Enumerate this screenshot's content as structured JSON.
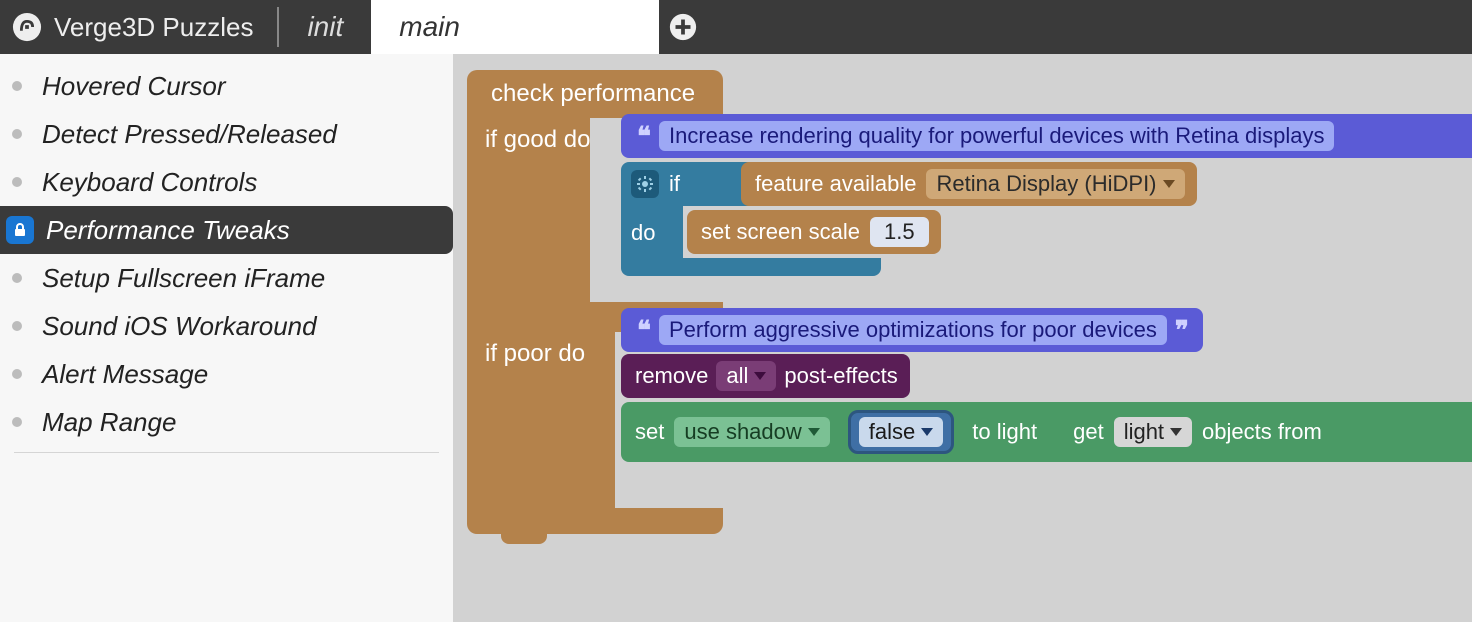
{
  "header": {
    "app_title": "Verge3D Puzzles",
    "tab_init": "init",
    "tab_main": "main"
  },
  "sidebar": {
    "items": [
      {
        "label": "Hovered Cursor"
      },
      {
        "label": "Detect Pressed/Released"
      },
      {
        "label": "Keyboard Controls"
      },
      {
        "label": "Performance Tweaks"
      },
      {
        "label": "Setup Fullscreen iFrame"
      },
      {
        "label": "Sound iOS Workaround"
      },
      {
        "label": "Alert Message"
      },
      {
        "label": "Map Range"
      }
    ],
    "active_index": 3
  },
  "blocks": {
    "check_performance": "check performance",
    "if_good_do": "if good do",
    "if_poor_do": "if poor do",
    "comment_good": "Increase rendering quality for powerful devices with Retina displays",
    "comment_poor": "Perform aggressive optimizations for poor devices",
    "if_word": "if",
    "do_word": "do",
    "feature_available": "feature available",
    "retina_option": "Retina Display (HiDPI)",
    "set_screen_scale": "set screen scale",
    "scale_value": "1.5",
    "remove": "remove",
    "all_option": "all",
    "post_effects": "post-effects",
    "set": "set",
    "use_shadow": "use shadow",
    "false_val": "false",
    "to_light": "to light",
    "get": "get",
    "light_option": "light",
    "objects_from": "objects from"
  }
}
